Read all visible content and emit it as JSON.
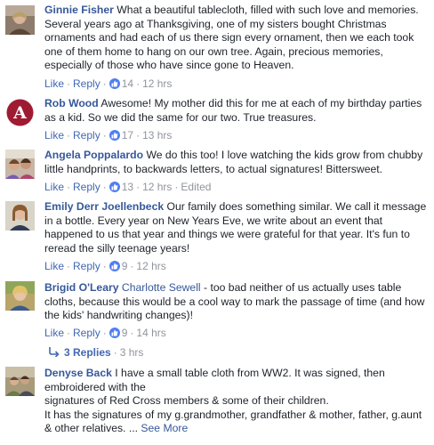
{
  "comments": [
    {
      "author": "Ginnie Fisher",
      "text": "What a beautiful tablecloth, filled with such love and memories. Several years ago at Thanksgiving, one of my sisters bought Christmas ornaments and had each of us there sign every ornament, then we each took one of them home to hang on our own tree. Again, precious memories, especially of those who have since gone to Heaven.",
      "like": "Like",
      "reply": "Reply",
      "likes": "14",
      "time": "12 hrs",
      "avatar_icon": "user-photo-icon"
    },
    {
      "author": "Rob Wood",
      "text": "Awesome! My mother did this for me at each of my birthday parties as a kid. So we did the same for our two. True treasures.",
      "like": "Like",
      "reply": "Reply",
      "likes": "17",
      "time": "13 hrs",
      "avatar_icon": "alabama-logo-icon"
    },
    {
      "author": "Angela Poppalardo",
      "text": "We do this too! I love watching the kids grow from chubby little handprints, to backwards letters, to actual signatures! Bittersweet.",
      "like": "Like",
      "reply": "Reply",
      "likes": "13",
      "time": "12 hrs",
      "edited": "Edited",
      "avatar_icon": "user-photo-icon"
    },
    {
      "author": "Emily Derr Joellenbeck",
      "text": "Our family does something similar. We call it message in a bottle. Every year on New Years Eve, we write about an event that happened to us that year and things we were grateful for that year. It's fun to reread the silly teenage years!",
      "like": "Like",
      "reply": "Reply",
      "likes": "9",
      "time": "12 hrs",
      "avatar_icon": "user-photo-icon"
    },
    {
      "author": "Brigid O'Leary",
      "mention": "Charlotte Sewell",
      "text": " - too bad neither of us actually uses table cloths, because this would be a cool way to mark the passage of time (and how the kids' handwriting changes)!",
      "like": "Like",
      "reply": "Reply",
      "likes": "9",
      "time": "14 hrs",
      "replies_label": "3 Replies",
      "replies_time": "3 hrs",
      "avatar_icon": "user-photo-icon"
    },
    {
      "author": "Denyse Back",
      "text_line1": "I have a small table cloth from WW2. It was signed, then embroidered with the",
      "text_line2": "signatures of Red Cross members & some of their children.",
      "text_line3": "It has the signatures of my g.grandmother, grandfather & mother, father, g.aunt & other relatives. ...",
      "see_more": "See More",
      "avatar_icon": "user-photo-icon"
    }
  ],
  "colors": {
    "link": "#365899",
    "action": "#4267b2",
    "meta": "#90949c",
    "like_badge": "#4f7ef2",
    "text": "#1d2129"
  }
}
